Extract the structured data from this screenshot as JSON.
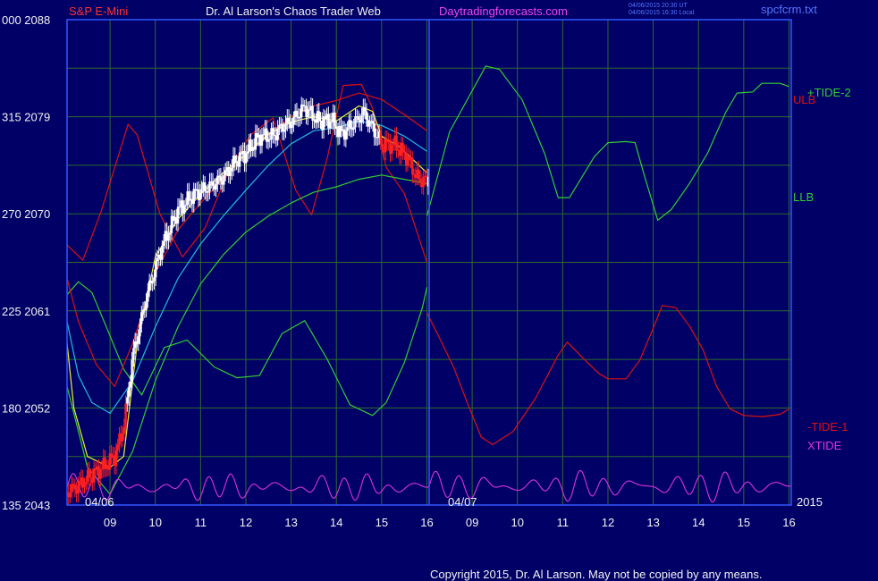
{
  "header": {
    "symbol": "S&P E-Mini",
    "title": "Dr. Al Larson's Chaos Trader Web",
    "site": "Daytradingforecasts.com",
    "stamp_line1": "04/06/2015 20:30 UT",
    "stamp_line2": "04/06/2015 16:30 Local",
    "file": "spcfcrm.txt"
  },
  "footer": {
    "copyright": "Copyright 2015, Dr. Al Larson. May not be copied by any means."
  },
  "colors": {
    "background": "#000066",
    "grid": "#2d6b2d",
    "axis_text": "#f2f2f2",
    "divider": "#3355ff",
    "symbol": "#ff3030",
    "title": "#f2f2f2",
    "site": "#ee44ee",
    "stamp": "#5577ff",
    "copyright": "#f2f2f2",
    "tide_plus_2": "#33cc33",
    "ulb": "#dd1111",
    "llb": "#33cc33",
    "tide_minus_1": "#dd1111",
    "xtide": "#dd33dd",
    "ma_slow": "#33cc33",
    "ma_mid": "#22bbdd",
    "ma_fast": "#dd1111",
    "ma_yellow": "#eeee33",
    "candles_up": "#ffffff",
    "candles_down": "#ff2020"
  },
  "chart_data": {
    "type": "line",
    "title": "S&P E-Mini",
    "xlabel": "",
    "ylabel": "",
    "grid": true,
    "y_ticks": [
      {
        "left": "135",
        "right": "2043",
        "value": 2043
      },
      {
        "left": "180",
        "right": "2052",
        "value": 2052
      },
      {
        "left": "225",
        "right": "2061",
        "value": 2061
      },
      {
        "left": "270",
        "right": "2070",
        "value": 2070
      },
      {
        "left": "315",
        "right": "2079",
        "value": 2079
      },
      {
        "left": "000",
        "right": "2088",
        "value": 2088
      }
    ],
    "ylim": [
      2043,
      2088
    ],
    "xlim": [
      8.05,
      16.05
    ],
    "x_ticks": [
      {
        "label": "09",
        "value": 9
      },
      {
        "label": "10",
        "value": 10
      },
      {
        "label": "11",
        "value": 11
      },
      {
        "label": "12",
        "value": 12
      },
      {
        "label": "13",
        "value": 13
      },
      {
        "label": "14",
        "value": 14
      },
      {
        "label": "15",
        "value": 15
      },
      {
        "label": "16",
        "value": 16
      }
    ],
    "date_labels": [
      "04/06",
      "04/07"
    ],
    "year_label": "2015",
    "right_labels": {
      "tide_plus_2": "+TIDE-2",
      "ulb": "ULB",
      "llb": "LLB",
      "tide_minus_1": "-TIDE-1",
      "xtide": "XTIDE"
    },
    "day1_series": [
      {
        "key": "ulb",
        "points": [
          [
            8.05,
            2067.1
          ],
          [
            8.4,
            2065.7
          ],
          [
            8.8,
            2070.2
          ],
          [
            9.4,
            2078.3
          ],
          [
            9.6,
            2077.3
          ],
          [
            10.1,
            2070
          ],
          [
            10.6,
            2066
          ],
          [
            11.1,
            2068.7
          ],
          [
            11.6,
            2073.8
          ],
          [
            12.1,
            2077.3
          ],
          [
            12.6,
            2078.9
          ],
          [
            13.1,
            2072.2
          ],
          [
            13.45,
            2069.9
          ],
          [
            13.8,
            2075.2
          ],
          [
            14.15,
            2081.9
          ],
          [
            14.55,
            2082
          ],
          [
            14.8,
            2079.8
          ],
          [
            15.1,
            2074.3
          ],
          [
            15.5,
            2071.9
          ],
          [
            16.0,
            2065.5
          ]
        ]
      },
      {
        "key": "llb",
        "points": [
          [
            8.05,
            2062.5
          ],
          [
            8.3,
            2063.7
          ],
          [
            8.6,
            2062.7
          ],
          [
            8.9,
            2059.7
          ],
          [
            9.3,
            2055.6
          ],
          [
            9.7,
            2053.2
          ],
          [
            10.2,
            2057.6
          ],
          [
            10.7,
            2058.3
          ],
          [
            11.3,
            2055.8
          ],
          [
            11.8,
            2054.8
          ],
          [
            12.3,
            2055
          ],
          [
            12.8,
            2058.9
          ],
          [
            13.3,
            2060.1
          ],
          [
            13.8,
            2056.5
          ],
          [
            14.3,
            2052.3
          ],
          [
            14.8,
            2051.3
          ],
          [
            15.1,
            2052.5
          ],
          [
            15.5,
            2056.2
          ],
          [
            15.9,
            2061.3
          ],
          [
            16.0,
            2063.2
          ]
        ]
      },
      {
        "key": "ma_slow",
        "points": [
          [
            8.05,
            2054
          ],
          [
            8.5,
            2046.5
          ],
          [
            9.0,
            2044
          ],
          [
            9.5,
            2048
          ],
          [
            10.0,
            2054.5
          ],
          [
            10.5,
            2059.5
          ],
          [
            11.0,
            2063.5
          ],
          [
            11.5,
            2066.2
          ],
          [
            12.0,
            2068.3
          ],
          [
            12.5,
            2069.8
          ],
          [
            13.0,
            2071
          ],
          [
            13.5,
            2072
          ],
          [
            14.0,
            2072.5
          ],
          [
            14.5,
            2073.2
          ],
          [
            15.0,
            2073.6
          ],
          [
            15.5,
            2073.2
          ],
          [
            16.0,
            2072.8
          ]
        ]
      },
      {
        "key": "ma_mid",
        "points": [
          [
            8.05,
            2060
          ],
          [
            8.3,
            2055
          ],
          [
            8.6,
            2052.5
          ],
          [
            9.0,
            2051.5
          ],
          [
            9.5,
            2054.5
          ],
          [
            10.0,
            2059.5
          ],
          [
            10.5,
            2064
          ],
          [
            11.0,
            2067.2
          ],
          [
            11.5,
            2069.8
          ],
          [
            12.0,
            2072.2
          ],
          [
            12.5,
            2074.5
          ],
          [
            13.0,
            2076.5
          ],
          [
            13.5,
            2077.7
          ],
          [
            14.0,
            2078
          ],
          [
            14.5,
            2078.6
          ],
          [
            15.0,
            2078.2
          ],
          [
            15.5,
            2077.2
          ],
          [
            16.0,
            2075.8
          ]
        ]
      },
      {
        "key": "ma_fast",
        "points": [
          [
            8.05,
            2064
          ],
          [
            8.3,
            2060
          ],
          [
            8.7,
            2056
          ],
          [
            9.1,
            2054
          ],
          [
            9.5,
            2058
          ],
          [
            10.0,
            2064.5
          ],
          [
            10.5,
            2068.5
          ],
          [
            11.0,
            2071
          ],
          [
            11.5,
            2073.3
          ],
          [
            12.0,
            2075.5
          ],
          [
            12.5,
            2077.3
          ],
          [
            13.0,
            2079
          ],
          [
            13.5,
            2080
          ],
          [
            14.0,
            2080.5
          ],
          [
            14.5,
            2081.2
          ],
          [
            15.0,
            2080.6
          ],
          [
            15.5,
            2079.2
          ],
          [
            16.0,
            2077.7
          ]
        ]
      },
      {
        "key": "ma_yellow",
        "points": [
          [
            8.05,
            2058
          ],
          [
            8.2,
            2052
          ],
          [
            8.5,
            2047.5
          ],
          [
            9.0,
            2046.5
          ],
          [
            9.3,
            2047.5
          ],
          [
            9.6,
            2058
          ],
          [
            10.0,
            2066
          ],
          [
            10.5,
            2069.5
          ],
          [
            11.0,
            2071.8
          ],
          [
            11.5,
            2073.8
          ],
          [
            12.0,
            2075.5
          ],
          [
            12.5,
            2077.4
          ],
          [
            13.0,
            2078.5
          ],
          [
            13.5,
            2079
          ],
          [
            14.0,
            2078.6
          ],
          [
            14.5,
            2080
          ],
          [
            14.8,
            2079.5
          ],
          [
            15.0,
            2077.2
          ],
          [
            15.4,
            2076.2
          ],
          [
            15.8,
            2074.6
          ],
          [
            16.0,
            2073.8
          ]
        ]
      }
    ],
    "day2_series": [
      {
        "key": "tide_plus_2",
        "points": [
          [
            8.0,
            2069.8
          ],
          [
            8.5,
            2077.6
          ],
          [
            9.3,
            2083.7
          ],
          [
            9.6,
            2083.4
          ],
          [
            10.1,
            2080.6
          ],
          [
            10.6,
            2075.6
          ],
          [
            10.9,
            2071.5
          ],
          [
            11.15,
            2071.5
          ],
          [
            11.7,
            2075.3
          ],
          [
            12.0,
            2076.6
          ],
          [
            12.4,
            2076.7
          ],
          [
            12.6,
            2076.6
          ],
          [
            12.8,
            2073.6
          ],
          [
            13.1,
            2069.4
          ],
          [
            13.4,
            2070.4
          ],
          [
            13.8,
            2072.8
          ],
          [
            14.2,
            2075.6
          ],
          [
            14.6,
            2079.4
          ],
          [
            14.85,
            2081.2
          ],
          [
            15.2,
            2081.3
          ],
          [
            15.4,
            2082.1
          ],
          [
            15.8,
            2082.1
          ],
          [
            16.0,
            2081.8
          ]
        ]
      },
      {
        "key": "tide_minus_1",
        "points": [
          [
            8.0,
            2060.8
          ],
          [
            8.3,
            2058.3
          ],
          [
            8.6,
            2055.7
          ],
          [
            8.9,
            2052.4
          ],
          [
            9.2,
            2049.3
          ],
          [
            9.45,
            2048.6
          ],
          [
            9.9,
            2049.8
          ],
          [
            10.4,
            2052.9
          ],
          [
            10.9,
            2056.9
          ],
          [
            11.1,
            2058.1
          ],
          [
            11.5,
            2056.4
          ],
          [
            11.8,
            2055.2
          ],
          [
            12.0,
            2054.7
          ],
          [
            12.4,
            2054.7
          ],
          [
            12.7,
            2056.4
          ],
          [
            13.0,
            2059.4
          ],
          [
            13.2,
            2061.5
          ],
          [
            13.5,
            2061.3
          ],
          [
            13.8,
            2059.6
          ],
          [
            14.1,
            2057.4
          ],
          [
            14.4,
            2054
          ],
          [
            14.7,
            2051.9
          ],
          [
            15.0,
            2051.3
          ],
          [
            15.4,
            2051.2
          ],
          [
            15.8,
            2051.4
          ],
          [
            16.0,
            2051.9
          ]
        ]
      },
      {
        "key": "xtide",
        "amplitude": [
          0.5,
          3.0
        ],
        "cycles": 15
      }
    ],
    "xtide_day1": {
      "key": "xtide",
      "amplitude": [
        0.5,
        2.8
      ],
      "cycles": 16
    },
    "price_candles": {
      "path": [
        [
          8.05,
          2044.2
        ],
        [
          8.3,
          2044.8
        ],
        [
          8.6,
          2045.8
        ],
        [
          8.85,
          2046.5
        ],
        [
          9.1,
          2047.5
        ],
        [
          9.3,
          2050.2
        ],
        [
          9.5,
          2056.8
        ],
        [
          9.8,
          2062.2
        ],
        [
          10.15,
          2067
        ],
        [
          10.5,
          2070.3
        ],
        [
          10.85,
          2071.8
        ],
        [
          11.2,
          2072.5
        ],
        [
          11.5,
          2073.4
        ],
        [
          11.8,
          2075
        ],
        [
          12.0,
          2075.6
        ],
        [
          12.3,
          2077.2
        ],
        [
          12.6,
          2077.2
        ],
        [
          12.8,
          2078.1
        ],
        [
          13.0,
          2078.5
        ],
        [
          13.3,
          2079.9
        ],
        [
          13.6,
          2078.6
        ],
        [
          13.9,
          2078.7
        ],
        [
          14.1,
          2077.4
        ],
        [
          14.4,
          2078.4
        ],
        [
          14.6,
          2079.4
        ],
        [
          14.8,
          2078
        ],
        [
          15.0,
          2076.4
        ],
        [
          15.3,
          2076.4
        ],
        [
          15.55,
          2075.3
        ],
        [
          15.8,
          2073.2
        ],
        [
          16.0,
          2073.1
        ]
      ],
      "red_ranges": [
        [
          8.05,
          9.35
        ],
        [
          14.95,
          16.0
        ]
      ]
    }
  }
}
